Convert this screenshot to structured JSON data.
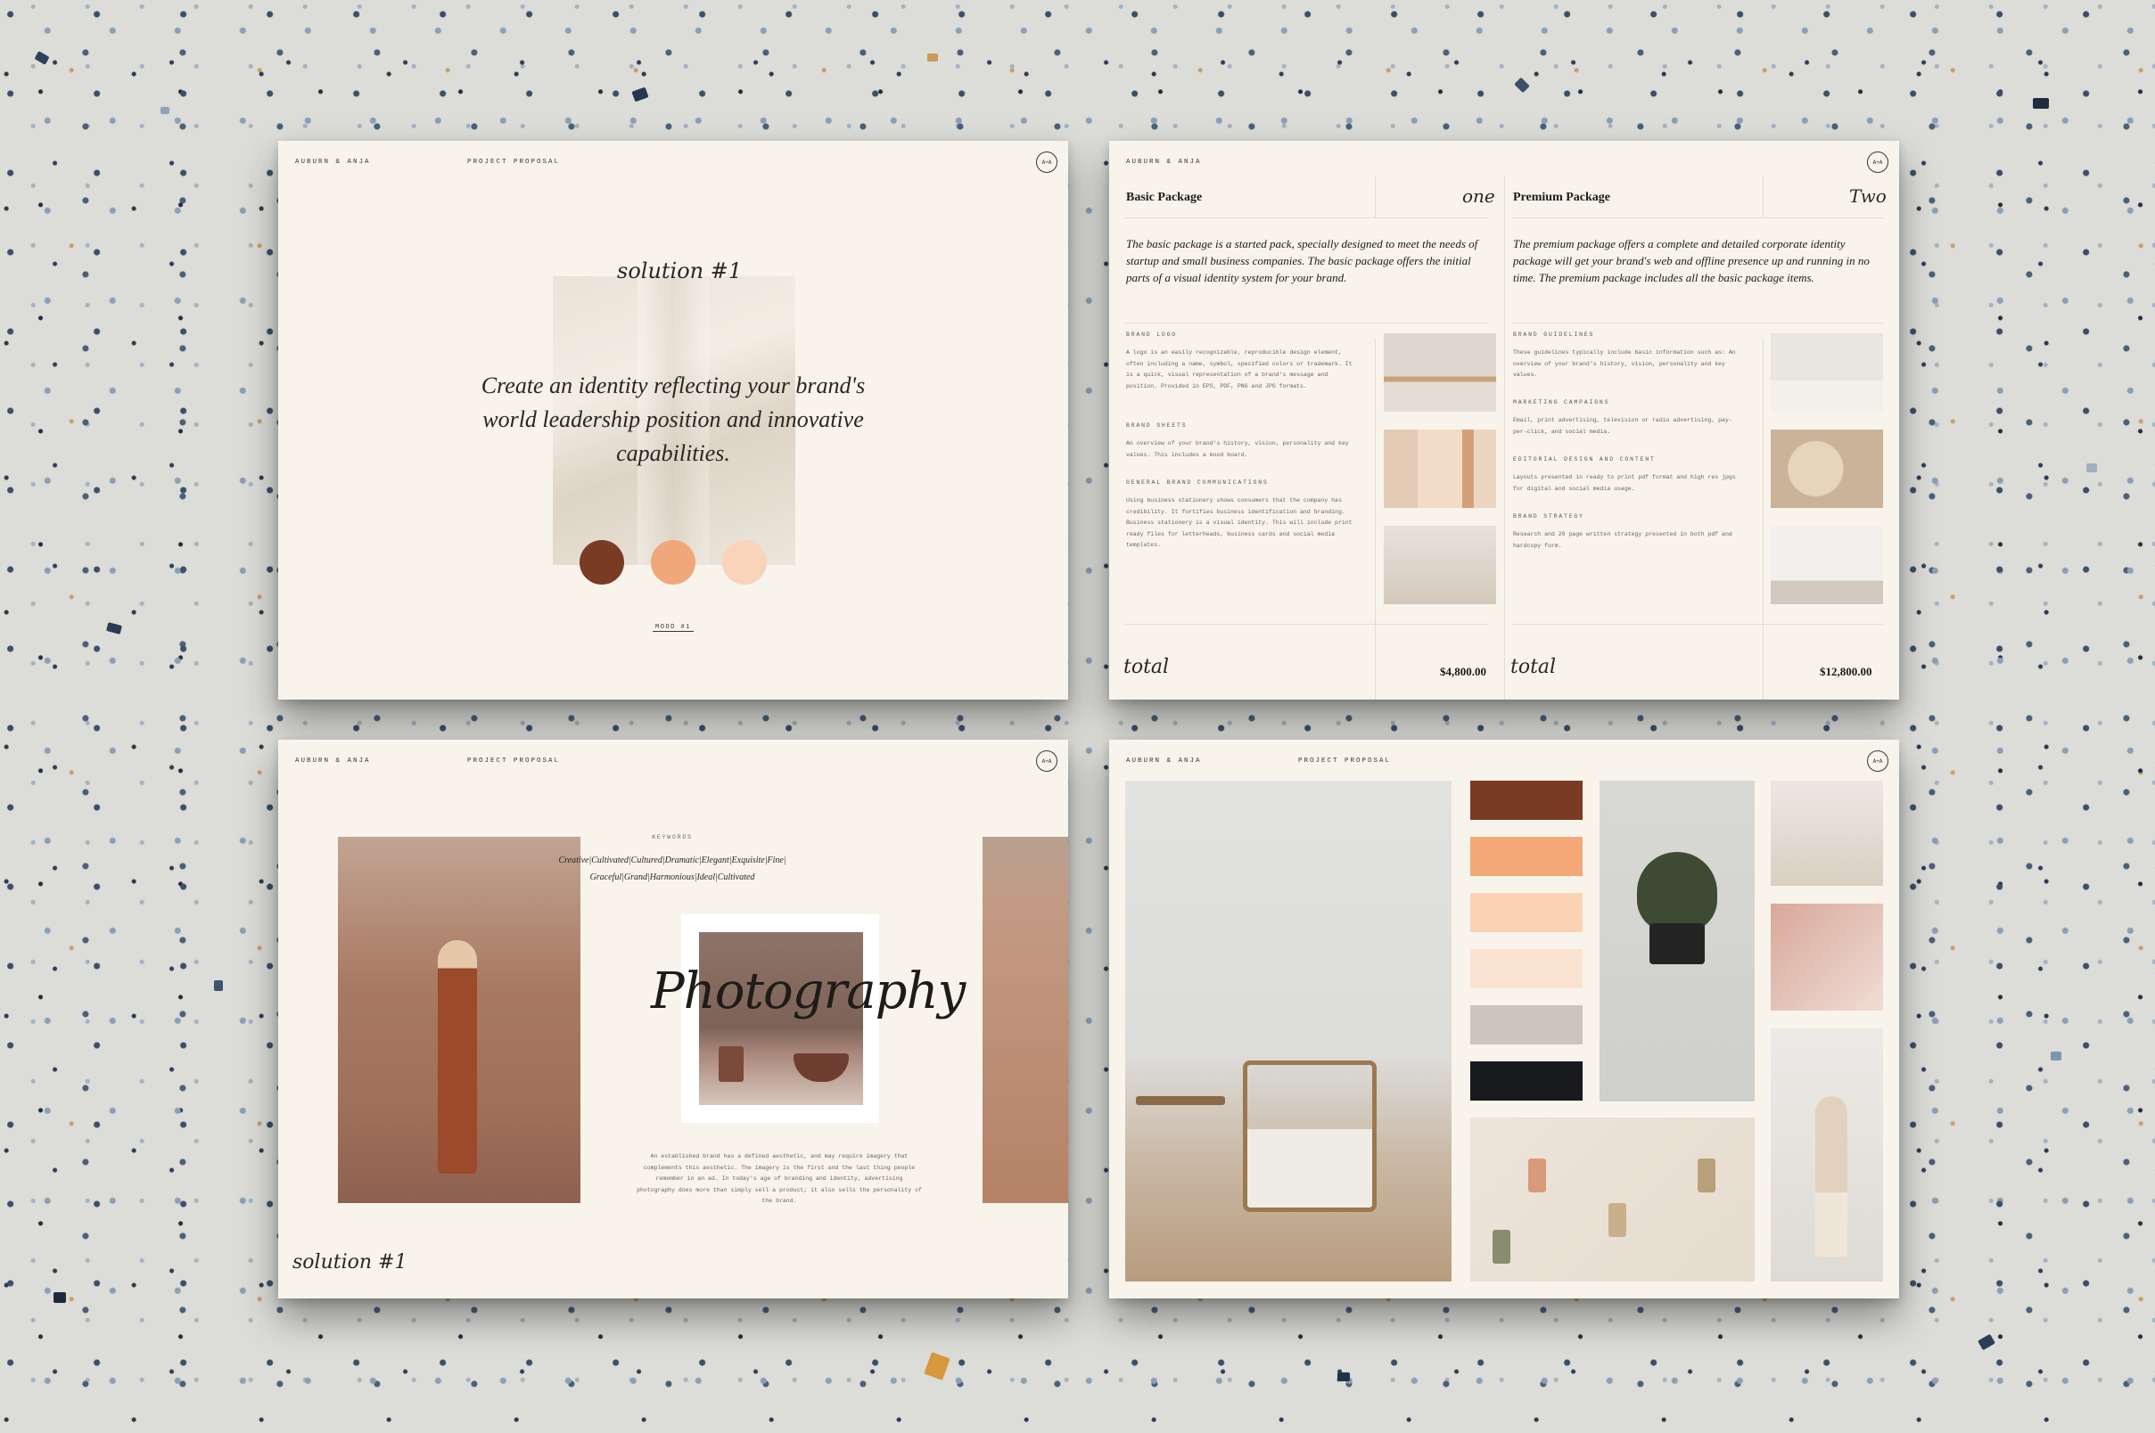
{
  "brand": "AUBURN & ANJA",
  "doc_type": "PROJECT PROPOSAL",
  "logo_mark": "A+A",
  "slide1": {
    "solution_label": "solution #1",
    "quote": "Create an identity reflecting your brand's world leadership position and innovative capabilities.",
    "mood_label": "MOOD #1",
    "palette": [
      "#7a3b24",
      "#f0a77a",
      "#f9d4bb"
    ]
  },
  "slide2": {
    "basic": {
      "title": "Basic Package",
      "num": "one",
      "desc": "The basic package is a started pack, specially designed to meet the needs of startup and small business companies. The basic package offers the initial parts of a visual identity system for your brand.",
      "items": [
        {
          "head": "BRAND LOGO",
          "text": "A logo is an easily recognizable, reproducible design element, often including a name, symbol, specified colors or trademark. It is a quick, visual representation of a brand's message and position. Provided in EPS, PDF, PNG and JPG formats."
        },
        {
          "head": "BRAND SHEETS",
          "text": "An overview of your brand's history, vision, personality and key values. This includes a mood board."
        },
        {
          "head": "GENERAL BRAND COMMUNICATIONS",
          "text": "Using business stationery shows consumers that the company has credibility. It fortifies business identification and branding. Business stationery is a visual identity. This will include print ready files for letterheads, business cards and social media templates."
        }
      ],
      "total_label": "total",
      "total": "$4,800.00"
    },
    "premium": {
      "title": "Premium Package",
      "num": "Two",
      "desc": "The premium package offers a complete and detailed corporate identity package will get your brand's web and offline presence up and running in no time. The premium package includes all the basic package items.",
      "items": [
        {
          "head": "BRAND GUIDELINES",
          "text": "These guidelines typically include basic information such as: An overview of your brand's history, vision, personality and key values."
        },
        {
          "head": "MARKETING CAMPAIGNS",
          "text": "Email, print advertising, television or radio advertising, pay-per-click, and social media."
        },
        {
          "head": "EDITORIAL DESIGN AND CONTENT",
          "text": "Layouts presented in ready to print pdf format and high res jpgs for digital and social media usage."
        },
        {
          "head": "BRAND STRATEGY",
          "text": "Research and 20 page written strategy presented in both pdf and hardcopy form."
        }
      ],
      "total_label": "total",
      "total": "$12,800.00"
    }
  },
  "slide3": {
    "keywords_label": "KEYWORDS",
    "keywords": "Creative|Cultivated|Cultured|Dramatic|Elegant|Exquisite|Fine| Graceful|Grand|Harmonious|Ideal|Cultivated",
    "title_word": "Photography",
    "body": "An established brand has a defined aesthetic, and may require imagery that complements this aesthetic. The imagery is the first and the last thing people remember in an ad. In today's age of branding and identity, advertising photography does more than simply sell a product; it also sells the personality of the brand.",
    "solution_label": "solution #1"
  },
  "slide4": {
    "swatches": [
      "#7b3a22",
      "#f4a878",
      "#fbd2b4",
      "#fbe3d2",
      "#cdc5bd",
      "#191a1d"
    ]
  }
}
